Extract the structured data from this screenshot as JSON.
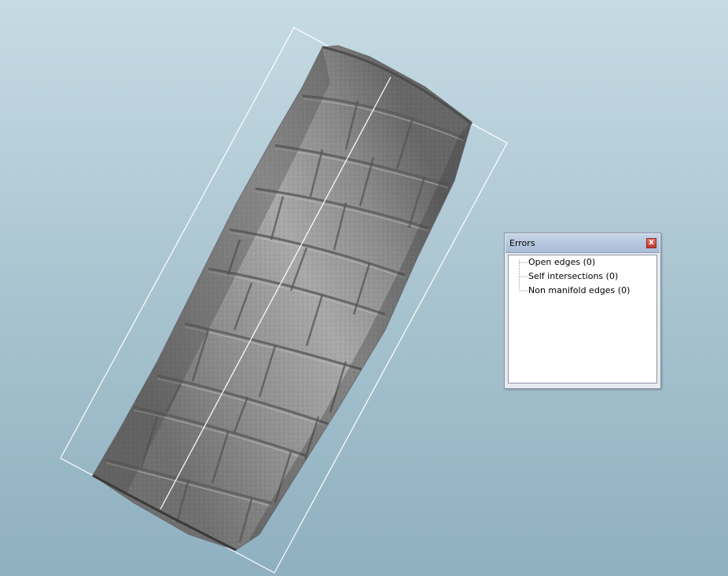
{
  "errors_panel": {
    "title": "Errors",
    "close_label": "x",
    "items": [
      {
        "label": "Open edges (0)"
      },
      {
        "label": "Self intersections (0)"
      },
      {
        "label": "Non manifold edges (0)"
      }
    ]
  },
  "viewport": {
    "model": "stone-brick-cylinder",
    "background_top": "#c6dbe4",
    "background_bottom": "#8fb0c0",
    "bounding_box_color": "#ffffff",
    "mesh_color": "#8a8a8a"
  }
}
